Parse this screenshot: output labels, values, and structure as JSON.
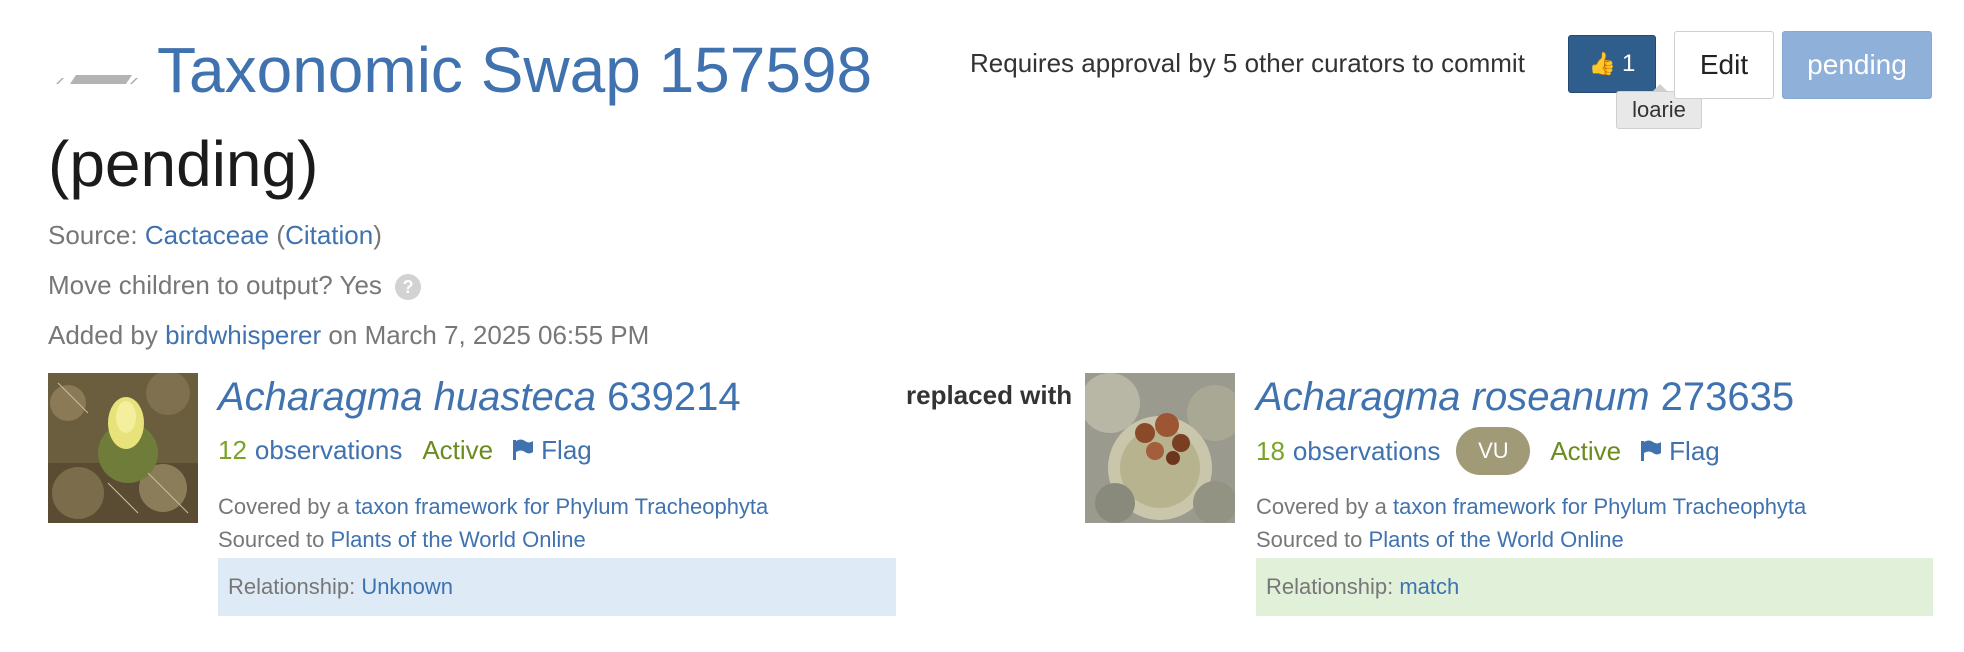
{
  "header": {
    "title": "Taxonomic Swap 157598",
    "status": "(pending)"
  },
  "meta": {
    "source_label": "Source:",
    "source_name": "Cactaceae",
    "source_paren_open": "(",
    "citation": "Citation",
    "source_paren_close": ")",
    "move_children_label": "Move children to output?",
    "move_children_value": "Yes",
    "added_by_label": "Added by",
    "added_by_user": "birdwhisperer",
    "added_on": "on March 7, 2025 06:55 PM"
  },
  "actions": {
    "approval_text": "Requires approval by 5 other curators to commit",
    "like_count": "1",
    "tooltip_user": "loarie",
    "edit_label": "Edit",
    "pending_label": "pending"
  },
  "input_taxon": {
    "name": "Acharagma huasteca",
    "id": "639214",
    "observations_count": "12",
    "observations_label": "observations",
    "status": "Active",
    "flag_label": "Flag",
    "covered_by_text": "Covered by a",
    "framework_link": "taxon framework for Phylum Tracheophyta",
    "sourced_to_text": "Sourced to",
    "sourced_link": "Plants of the World Online",
    "relationship_label": "Relationship:",
    "relationship_value": "Unknown"
  },
  "connector": {
    "label": "replaced with"
  },
  "output_taxon": {
    "name": "Acharagma roseanum",
    "id": "273635",
    "observations_count": "18",
    "observations_label": "observations",
    "conservation_badge": "VU",
    "status": "Active",
    "flag_label": "Flag",
    "covered_by_text": "Covered by a",
    "framework_link": "taxon framework for Phylum Tracheophyta",
    "sourced_to_text": "Sourced to",
    "sourced_link": "Plants of the World Online",
    "relationship_label": "Relationship:",
    "relationship_value": "match"
  },
  "colors": {
    "link": "#3f72af",
    "observations_count": "#7aa327",
    "active": "#6c8b1f",
    "like_button": "#2f5d8c",
    "pending_button": "#8fb1d9",
    "vu_badge": "#a09a76",
    "relationship_unknown_bg": "#deebf6",
    "relationship_match_bg": "#e1f0d9"
  },
  "icons": {
    "swap": "swap-icon",
    "like": "thumbs-up-icon",
    "help": "help-icon",
    "flag": "flag-icon"
  }
}
